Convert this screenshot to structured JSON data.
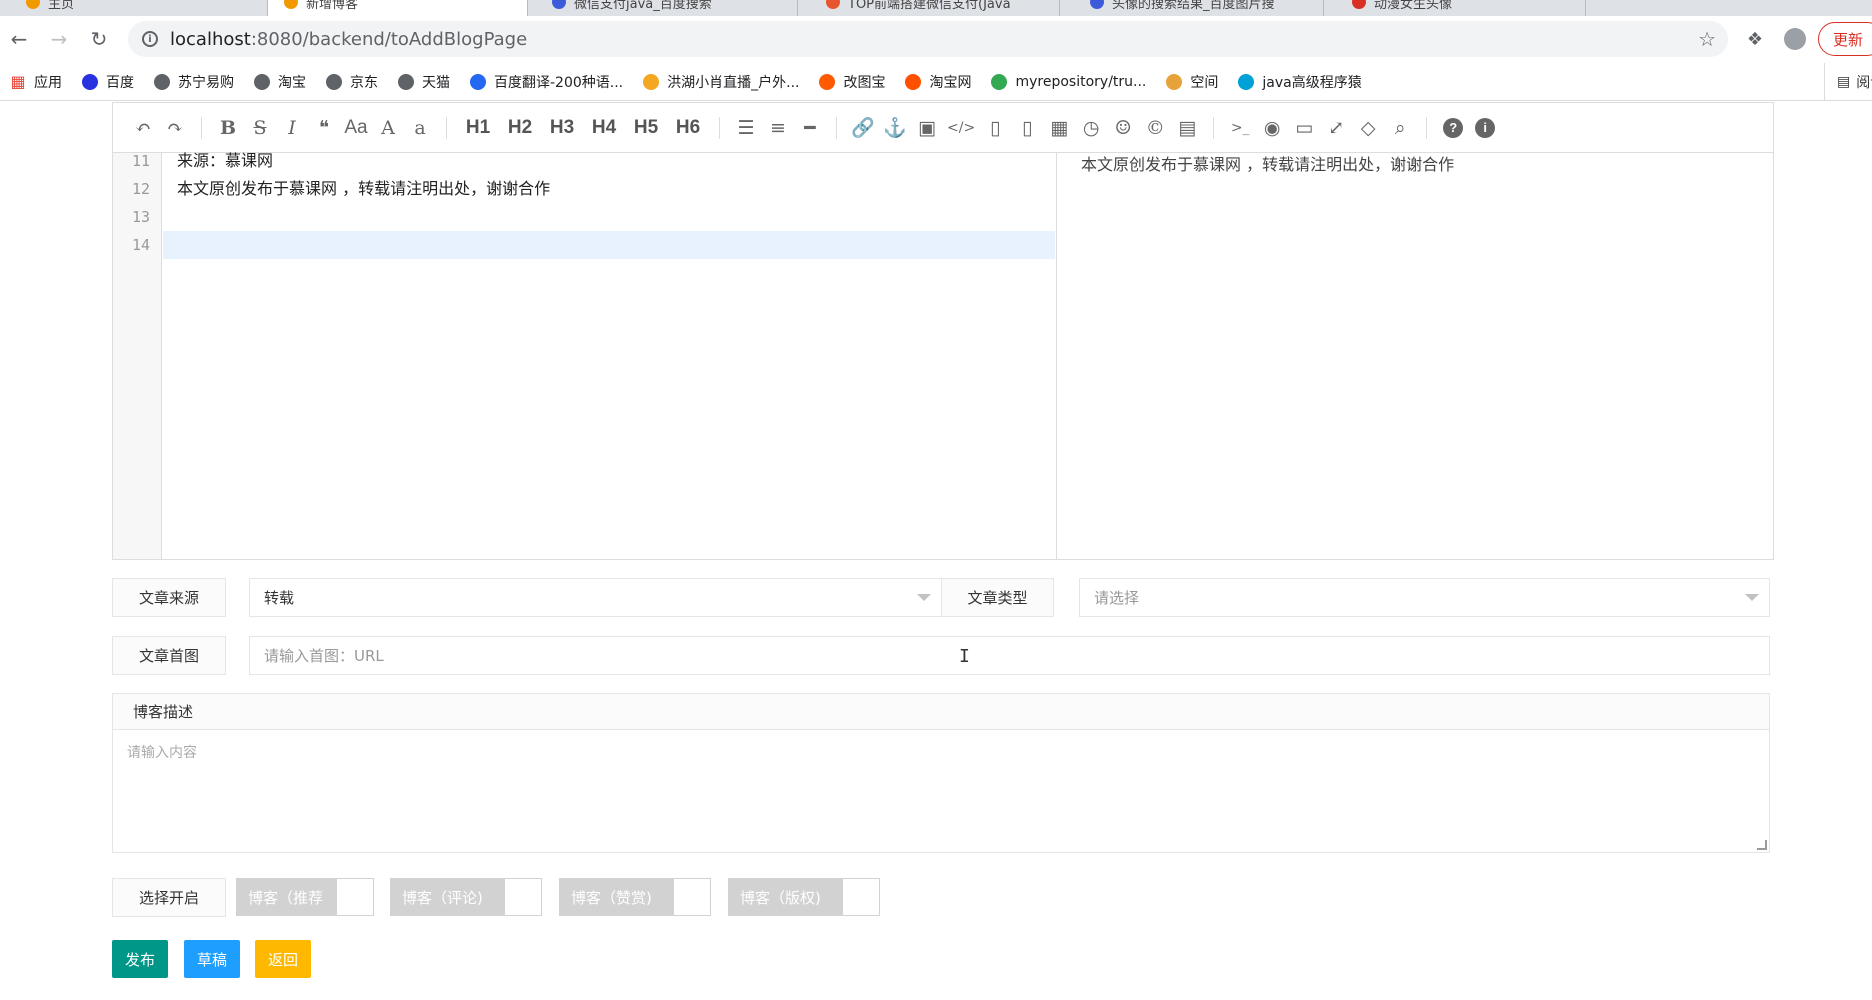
{
  "browser": {
    "tabs": [
      {
        "title": "主页"
      },
      {
        "title": "新增博客"
      },
      {
        "title": "微信支付java_百度搜索"
      },
      {
        "title": "TOP前端搭建微信支付(Java"
      },
      {
        "title": "头像的搜索结果_百度图片搜"
      },
      {
        "title": "动漫女生头像"
      }
    ],
    "url_host": "localhost",
    "url_path": ":8080/backend/toAddBlogPage",
    "update_label": "更新",
    "bookmarks": [
      {
        "label": "应用",
        "icon": "apps-grid-icon",
        "color": "#4285f4"
      },
      {
        "label": "百度",
        "icon": "baidu-paw-icon",
        "color": "#2932e1"
      },
      {
        "label": "苏宁易购",
        "icon": "globe-icon",
        "color": "#5f6368"
      },
      {
        "label": "淘宝",
        "icon": "globe-icon",
        "color": "#5f6368"
      },
      {
        "label": "京东",
        "icon": "globe-icon",
        "color": "#5f6368"
      },
      {
        "label": "天猫",
        "icon": "globe-icon",
        "color": "#5f6368"
      },
      {
        "label": "百度翻译-200种语...",
        "icon": "translate-icon",
        "color": "#2468f2"
      },
      {
        "label": "洪湖小肖直播_户外...",
        "icon": "huya-icon",
        "color": "#f5a623"
      },
      {
        "label": "改图宝",
        "icon": "gaitubao-icon",
        "color": "#ff5a00"
      },
      {
        "label": "淘宝网",
        "icon": "taobao-icon",
        "color": "#ff5000"
      },
      {
        "label": "myrepository/tru...",
        "icon": "chrome-icon",
        "color": "#34a853"
      },
      {
        "label": "空间",
        "icon": "qzone-icon",
        "color": "#e8a23a"
      },
      {
        "label": "java高级程序猿",
        "icon": "bilibili-icon",
        "color": "#00a1d6"
      }
    ],
    "reading_list": "阅读清"
  },
  "editor": {
    "toolbar": [
      "undo-icon",
      "redo-icon",
      "|",
      "bold-icon",
      "strikethrough-icon",
      "italic-icon",
      "quote-icon",
      "uppercase-icon",
      "ucwords-icon",
      "lowercase-icon",
      "|",
      "H1",
      "H2",
      "H3",
      "H4",
      "H5",
      "H6",
      "|",
      "list-ul-icon",
      "list-ol-icon",
      "hr-icon",
      "|",
      "link-icon",
      "anchor-icon",
      "image-icon",
      "code-icon",
      "preformatted-text-icon",
      "code-block-icon",
      "table-icon",
      "datetime-icon",
      "emoji-icon",
      "html-entities-icon",
      "pagebreak-icon",
      "|",
      "goto-line-icon",
      "watch-icon",
      "preview-icon",
      "fullscreen-icon",
      "clear-icon",
      "search-icon",
      "|",
      "help-icon",
      "info-icon"
    ],
    "lines": [
      {
        "no": "11",
        "text": "来源：慕课网"
      },
      {
        "no": "12",
        "text": "本文原创发布于慕课网 ，转载请注明出处，谢谢合作"
      },
      {
        "no": "13",
        "text": ""
      },
      {
        "no": "14",
        "text": ""
      }
    ],
    "preview_text": "本文原创发布于慕课网 ，转载请注明出处，谢谢合作"
  },
  "form": {
    "source_label": "文章来源",
    "source_value": "转载",
    "type_label": "文章类型",
    "type_placeholder": "请选择",
    "cover_label": "文章首图",
    "cover_placeholder": "请输入首图：URL",
    "desc_label": "博客描述",
    "desc_placeholder": "请输入内容",
    "toggle_label": "选择开启",
    "switches": [
      "博客（推荐",
      "博客（评论)",
      "博客（赞赏)",
      "博客（版权)"
    ],
    "publish": "发布",
    "draft": "草稿",
    "back": "返回"
  },
  "colors": {
    "publish": "#009688",
    "draft": "#1e9fff",
    "back": "#ffb800"
  }
}
